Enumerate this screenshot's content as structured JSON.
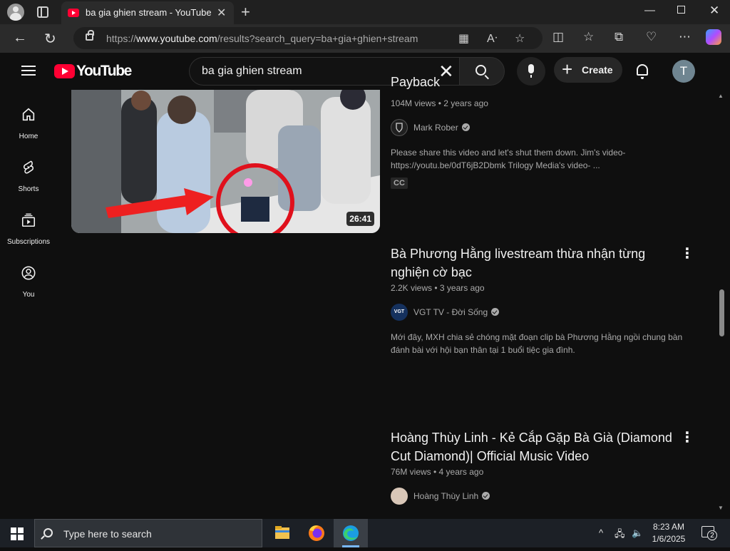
{
  "browser": {
    "tab_title": "ba gia ghien stream - YouTube",
    "url_host": "www.youtube.com",
    "url_prefix": "https://",
    "url_path": "/results?search_query=ba+gia+ghien+stream"
  },
  "youtube": {
    "logo_text": "YouTube",
    "search_value": "ba gia ghien stream",
    "create_label": "Create",
    "avatar_letter": "T"
  },
  "sidebar": {
    "items": [
      {
        "label": "Home",
        "icon": "home-icon"
      },
      {
        "label": "Shorts",
        "icon": "shorts-icon"
      },
      {
        "label": "Subscriptions",
        "icon": "subscriptions-icon"
      },
      {
        "label": "You",
        "icon": "you-icon"
      }
    ]
  },
  "results": [
    {
      "title_partial": "Payback",
      "duration": "26:41",
      "meta": "104M views • 2 years ago",
      "channel": "Mark Rober",
      "verified": true,
      "description": "Please share this video and let's shut them down. Jim's video- https://youtu.be/0dT6jB2Dbmk Trilogy Media's video- ...",
      "badge": "CC"
    },
    {
      "title": "Bà Phương Hằng livestream thừa nhận từng nghiện cờ bạc",
      "meta": "2.2K views • 3 years ago",
      "channel": "VGT TV - Đời Sống",
      "channel_avatar_text": "VGT",
      "verified": true,
      "description": "Mới đây, MXH chia sẻ chóng mặt đoạn clip bà Phương Hằng ngồi chung bàn đánh bài với hội bạn thân tại 1 buổi tiệc gia đình."
    },
    {
      "title": "Hoàng Thùy Linh - Kẻ Cắp Gặp Bà Già (Diamond Cut Diamond)| Official Music Video",
      "meta": "76M views • 4 years ago",
      "channel": "Hoàng Thùy Linh",
      "verified": true
    }
  ],
  "taskbar": {
    "search_placeholder": "Type here to search",
    "time": "8:23 AM",
    "date": "1/6/2025",
    "notification_count": "2"
  },
  "colors": {
    "background": "#0f0f0f",
    "youtube_red": "#ff0033",
    "text_primary": "#f1f1f1",
    "text_secondary": "#aaaaaa"
  }
}
